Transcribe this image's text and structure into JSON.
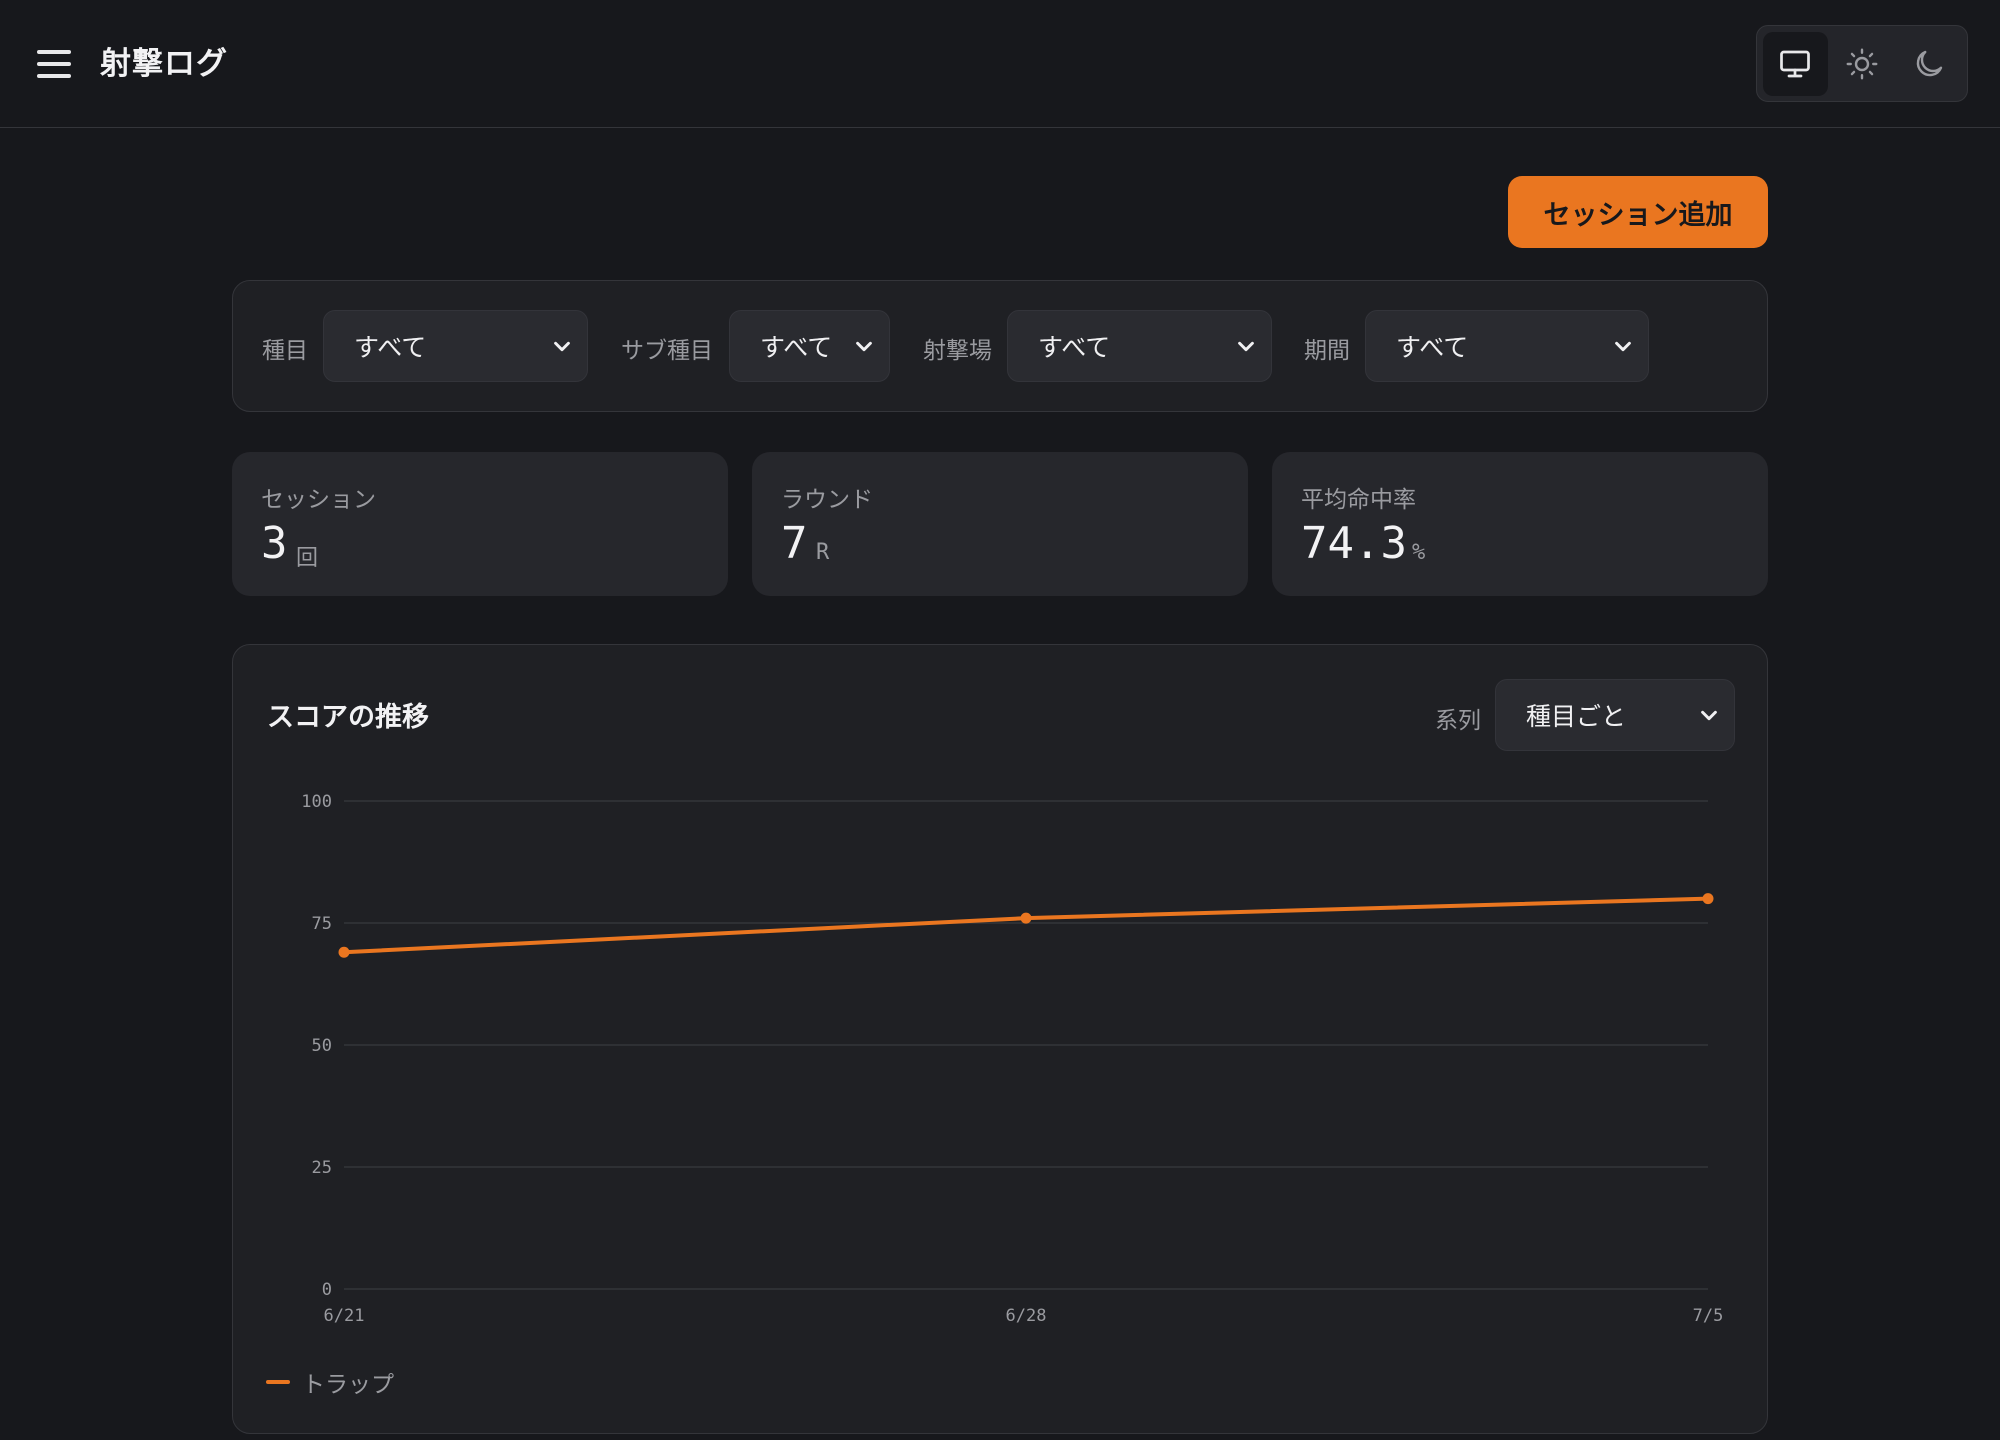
{
  "header": {
    "title": "射撃ログ",
    "theme_options": [
      {
        "icon": "monitor-icon",
        "active": true
      },
      {
        "icon": "sun-icon",
        "active": false
      },
      {
        "icon": "moon-icon",
        "active": false
      }
    ]
  },
  "actions": {
    "add_session_label": "セッション追加"
  },
  "filters": {
    "event": {
      "label": "種目",
      "value": "すべて"
    },
    "sub_event": {
      "label": "サブ種目",
      "value": "すべて"
    },
    "range": {
      "label": "射撃場",
      "value": "すべて"
    },
    "period": {
      "label": "期間",
      "value": "すべて"
    }
  },
  "stats": {
    "sessions": {
      "label": "セッション",
      "value": "3",
      "unit": "回"
    },
    "rounds": {
      "label": "ラウンド",
      "value": "7",
      "unit": "R"
    },
    "hit_rate": {
      "label": "平均命中率",
      "value": "74.3",
      "unit": "%"
    }
  },
  "chart": {
    "title": "スコアの推移",
    "series_label": "系列",
    "series_value": "種目ごと"
  },
  "colors": {
    "accent": "#ea7620",
    "background": "#17181c",
    "panel": "#1f2024",
    "card": "#26272c"
  },
  "chart_data": {
    "type": "line",
    "categories": [
      "6/21",
      "6/28",
      "7/5"
    ],
    "series": [
      {
        "name": "トラップ",
        "values": [
          69,
          76,
          80
        ],
        "color": "#ea7620"
      }
    ],
    "ylim": [
      0,
      100
    ],
    "yticks": [
      0,
      25,
      50,
      75,
      100
    ],
    "grid": true,
    "legend": "bottom-left"
  }
}
